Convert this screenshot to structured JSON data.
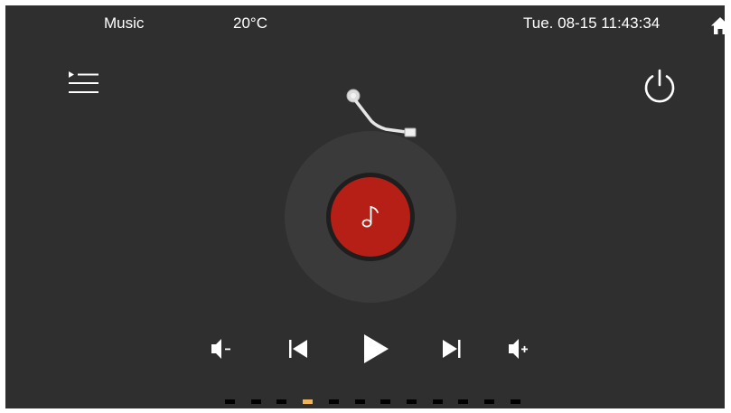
{
  "status_bar": {
    "app_title": "Music",
    "temperature": "20°C",
    "datetime": "Tue. 08-15 11:43:34",
    "home_icon": "home-icon"
  },
  "toolbar": {
    "playlist_icon": "playlist-icon",
    "power_icon": "power-icon"
  },
  "player": {
    "disc_color": "#b51f15",
    "note_icon": "music-note-icon",
    "controls": [
      {
        "name": "volume-down",
        "icon": "volume-down-icon"
      },
      {
        "name": "previous",
        "icon": "skip-previous-icon"
      },
      {
        "name": "play",
        "icon": "play-icon"
      },
      {
        "name": "next",
        "icon": "skip-next-icon"
      },
      {
        "name": "volume-up",
        "icon": "volume-up-icon"
      }
    ]
  },
  "pager": {
    "page_count": 12,
    "active_page": 4,
    "active_color": "#f2b25a"
  }
}
